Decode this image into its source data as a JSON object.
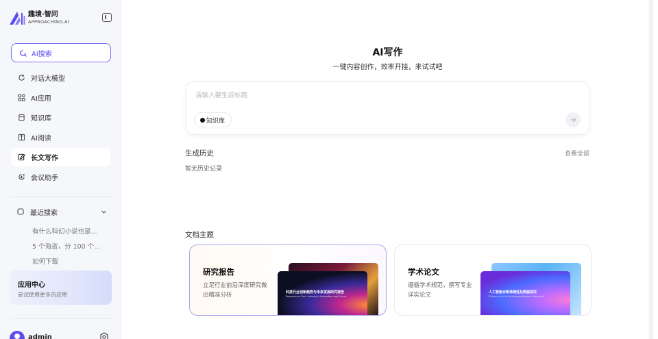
{
  "brand": {
    "name_cn": "趣境·智问",
    "name_en": "APPROACHING.AI"
  },
  "sidebar": {
    "search_label": "AI搜索",
    "items": [
      {
        "label": "对话大模型",
        "icon": "chat-refresh-icon",
        "active": false
      },
      {
        "label": "AI应用",
        "icon": "apps-grid-icon",
        "active": false
      },
      {
        "label": "知识库",
        "icon": "database-icon",
        "active": false
      },
      {
        "label": "AI阅读",
        "icon": "book-open-icon",
        "active": false
      },
      {
        "label": "长文写作",
        "icon": "edit-document-icon",
        "active": true
      },
      {
        "label": "会议助手",
        "icon": "meeting-icon",
        "active": false
      }
    ],
    "recent": {
      "title": "最近搜索",
      "items": [
        "有什么科幻小说也是...",
        "5 个海盗，分 100 个...",
        "如何下载"
      ]
    },
    "app_center": {
      "title": "应用中心",
      "subtitle": "尝试使用更多的应用"
    },
    "user": {
      "name": "admin"
    }
  },
  "main": {
    "title": "AI写作",
    "subtitle": "一键内容创作，效率开挂，来试试吧",
    "prompt": {
      "placeholder": "请输入要生成标题",
      "value": "",
      "kb_chip": "知识库"
    },
    "history": {
      "title": "生成历史",
      "view_all": "查看全部",
      "empty": "暂无历史记录"
    },
    "topics": {
      "title": "文档主题",
      "cards": [
        {
          "title": "研究报告",
          "desc": "立足行业前沿深度研究做出精准分析",
          "cover_title": "科技行业创新趋势与未来发展研究报告",
          "cover_subtitle": "Research on Tech Industry's Innovation and Future"
        },
        {
          "title": "学术论文",
          "desc": "遵循学术规范，撰写专业详实论文",
          "cover_title": "人工智能诊断准确性及数据探究",
          "cover_subtitle": "Efficacy of AI in Preliminary Medical Diagnosis"
        }
      ]
    }
  },
  "colors": {
    "accent": "#5b4cf0",
    "active_border": "#a9a2f2"
  }
}
